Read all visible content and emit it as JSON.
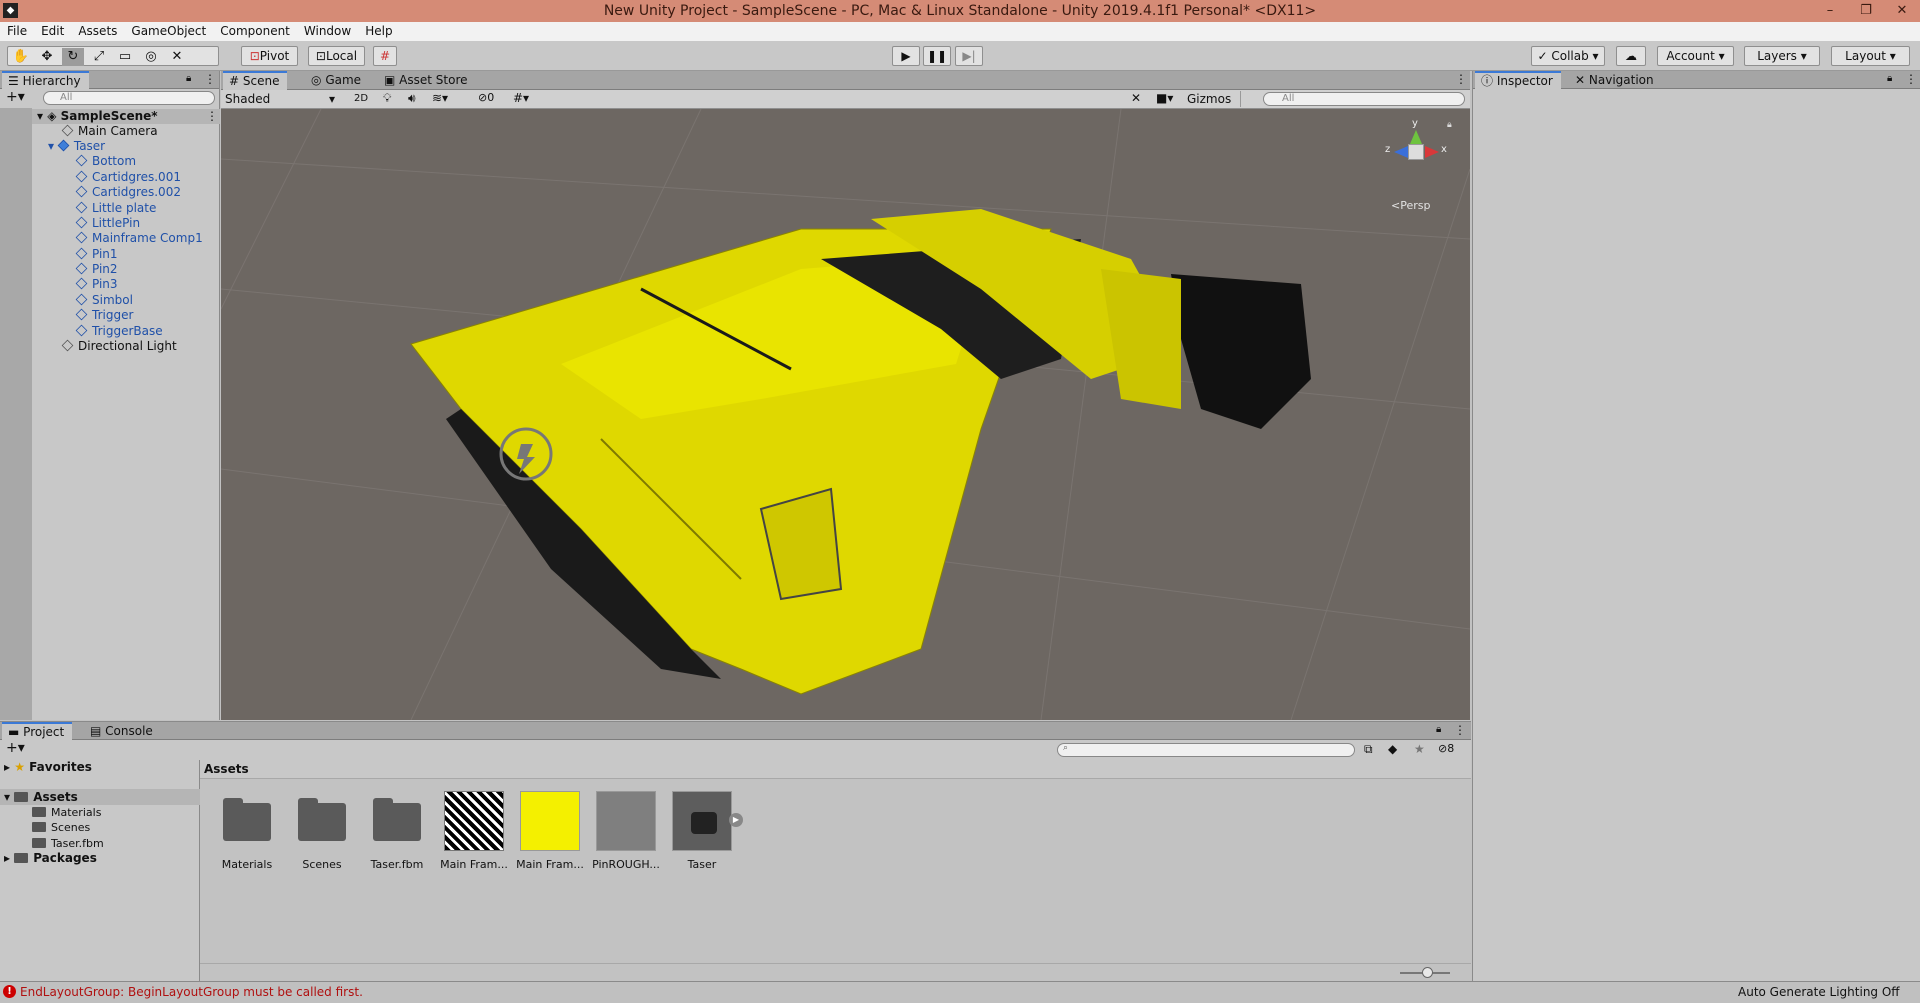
{
  "window": {
    "title": "New Unity Project - SampleScene - PC, Mac & Linux Standalone - Unity 2019.4.1f1 Personal* <DX11>",
    "minimize": "–",
    "restore": "❐",
    "close": "✕"
  },
  "menu": [
    "File",
    "Edit",
    "Assets",
    "GameObject",
    "Component",
    "Window",
    "Help"
  ],
  "toolbar": {
    "pivot": "Pivot",
    "local": "Local",
    "collab": "Collab",
    "account": "Account",
    "layers": "Layers",
    "layout": "Layout"
  },
  "hierarchy": {
    "tab": "Hierarchy",
    "search_placeholder": "All",
    "scene": "SampleScene*",
    "items": [
      "Main Camera",
      "Taser",
      "Bottom",
      "Cartidgres.001",
      "Cartidgres.002",
      "Little plate",
      "LittlePin",
      "Mainframe Comp1",
      "Pin1",
      "Pin2",
      "Pin3",
      "Simbol",
      "Trigger",
      "TriggerBase",
      "Directional Light"
    ]
  },
  "scene": {
    "tabs": [
      "Scene",
      "Game",
      "Asset Store"
    ],
    "shading": "Shaded",
    "mode_2d": "2D",
    "hidden_count": "0",
    "gizmos": "Gizmos",
    "search_placeholder": "All",
    "persp": "Persp",
    "axis_y": "y",
    "axis_x": "x",
    "axis_z": "z"
  },
  "inspector": {
    "tabs": [
      "Inspector",
      "Navigation"
    ]
  },
  "project": {
    "tabs": [
      "Project",
      "Console"
    ],
    "badge_count": "8",
    "tree": [
      "Favorites",
      "Assets",
      "Materials",
      "Scenes",
      "Taser.fbm",
      "Packages"
    ],
    "breadcrumb": "Assets",
    "assets": [
      "Materials",
      "Scenes",
      "Taser.fbm",
      "Main Fram...",
      "Main Fram...",
      "PinROUGH...",
      "Taser"
    ]
  },
  "status": {
    "error": "EndLayoutGroup: BeginLayoutGroup must be called first.",
    "right": "Auto Generate Lighting Off"
  },
  "colors": {
    "titlebar": "#d58b76",
    "viewport": "#6d6762",
    "taser_yellow": "#e8e200",
    "selection_blue": "#1f50a8",
    "error_red": "#b01010"
  }
}
